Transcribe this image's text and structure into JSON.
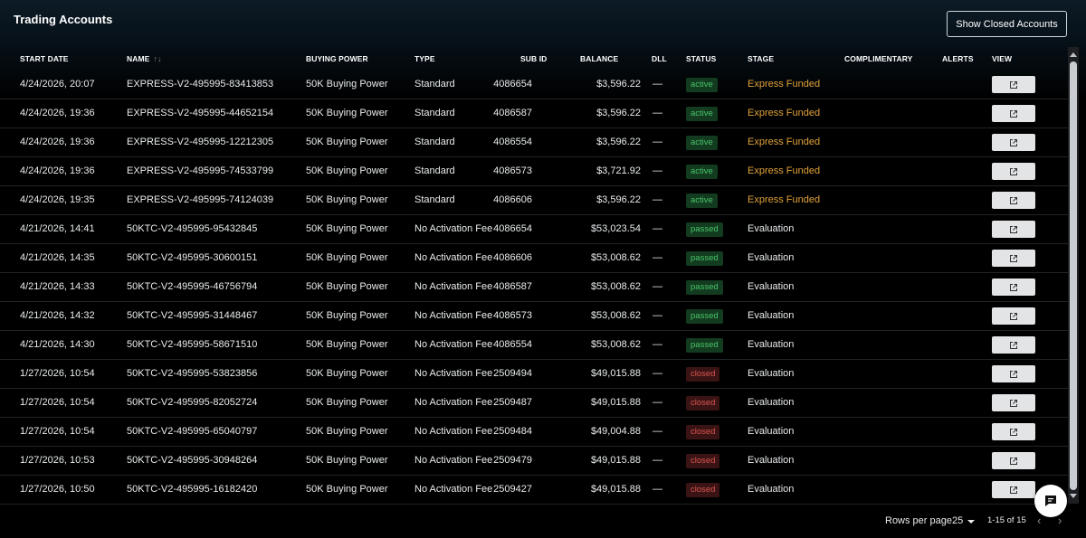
{
  "page": {
    "title": "Trading Accounts",
    "show_closed_label": "Show Closed Accounts"
  },
  "table": {
    "headers": {
      "start_date": "START DATE",
      "name": "NAME",
      "buying_power": "BUYING POWER",
      "type": "TYPE",
      "sub_id": "SUB ID",
      "balance": "BALANCE",
      "dll": "DLL",
      "status": "STATUS",
      "stage": "STAGE",
      "complimentary": "COMPLIMENTARY",
      "alerts": "ALERTS",
      "view": "VIEW"
    },
    "rows": [
      {
        "start_date": "4/24/2026, 20:07",
        "name": "EXPRESS-V2-495995-83413853",
        "buying_power": "50K Buying Power",
        "type": "Standard",
        "sub_id": "4086654",
        "balance": "$3,596.22",
        "dll": "—",
        "status": "active",
        "stage": "Express Funded"
      },
      {
        "start_date": "4/24/2026, 19:36",
        "name": "EXPRESS-V2-495995-44652154",
        "buying_power": "50K Buying Power",
        "type": "Standard",
        "sub_id": "4086587",
        "balance": "$3,596.22",
        "dll": "—",
        "status": "active",
        "stage": "Express Funded"
      },
      {
        "start_date": "4/24/2026, 19:36",
        "name": "EXPRESS-V2-495995-12212305",
        "buying_power": "50K Buying Power",
        "type": "Standard",
        "sub_id": "4086554",
        "balance": "$3,596.22",
        "dll": "—",
        "status": "active",
        "stage": "Express Funded"
      },
      {
        "start_date": "4/24/2026, 19:36",
        "name": "EXPRESS-V2-495995-74533799",
        "buying_power": "50K Buying Power",
        "type": "Standard",
        "sub_id": "4086573",
        "balance": "$3,721.92",
        "dll": "—",
        "status": "active",
        "stage": "Express Funded"
      },
      {
        "start_date": "4/24/2026, 19:35",
        "name": "EXPRESS-V2-495995-74124039",
        "buying_power": "50K Buying Power",
        "type": "Standard",
        "sub_id": "4086606",
        "balance": "$3,596.22",
        "dll": "—",
        "status": "active",
        "stage": "Express Funded"
      },
      {
        "start_date": "4/21/2026, 14:41",
        "name": "50KTC-V2-495995-95432845",
        "buying_power": "50K Buying Power",
        "type": "No Activation Fee",
        "sub_id": "4086654",
        "balance": "$53,023.54",
        "dll": "—",
        "status": "passed",
        "stage": "Evaluation"
      },
      {
        "start_date": "4/21/2026, 14:35",
        "name": "50KTC-V2-495995-30600151",
        "buying_power": "50K Buying Power",
        "type": "No Activation Fee",
        "sub_id": "4086606",
        "balance": "$53,008.62",
        "dll": "—",
        "status": "passed",
        "stage": "Evaluation"
      },
      {
        "start_date": "4/21/2026, 14:33",
        "name": "50KTC-V2-495995-46756794",
        "buying_power": "50K Buying Power",
        "type": "No Activation Fee",
        "sub_id": "4086587",
        "balance": "$53,008.62",
        "dll": "—",
        "status": "passed",
        "stage": "Evaluation"
      },
      {
        "start_date": "4/21/2026, 14:32",
        "name": "50KTC-V2-495995-31448467",
        "buying_power": "50K Buying Power",
        "type": "No Activation Fee",
        "sub_id": "4086573",
        "balance": "$53,008.62",
        "dll": "—",
        "status": "passed",
        "stage": "Evaluation"
      },
      {
        "start_date": "4/21/2026, 14:30",
        "name": "50KTC-V2-495995-58671510",
        "buying_power": "50K Buying Power",
        "type": "No Activation Fee",
        "sub_id": "4086554",
        "balance": "$53,008.62",
        "dll": "—",
        "status": "passed",
        "stage": "Evaluation"
      },
      {
        "start_date": "1/27/2026, 10:54",
        "name": "50KTC-V2-495995-53823856",
        "buying_power": "50K Buying Power",
        "type": "No Activation Fee",
        "sub_id": "2509494",
        "balance": "$49,015.88",
        "dll": "—",
        "status": "closed",
        "stage": "Evaluation"
      },
      {
        "start_date": "1/27/2026, 10:54",
        "name": "50KTC-V2-495995-82052724",
        "buying_power": "50K Buying Power",
        "type": "No Activation Fee",
        "sub_id": "2509487",
        "balance": "$49,015.88",
        "dll": "—",
        "status": "closed",
        "stage": "Evaluation"
      },
      {
        "start_date": "1/27/2026, 10:54",
        "name": "50KTC-V2-495995-65040797",
        "buying_power": "50K Buying Power",
        "type": "No Activation Fee",
        "sub_id": "2509484",
        "balance": "$49,004.88",
        "dll": "—",
        "status": "closed",
        "stage": "Evaluation"
      },
      {
        "start_date": "1/27/2026, 10:53",
        "name": "50KTC-V2-495995-30948264",
        "buying_power": "50K Buying Power",
        "type": "No Activation Fee",
        "sub_id": "2509479",
        "balance": "$49,015.88",
        "dll": "—",
        "status": "closed",
        "stage": "Evaluation"
      },
      {
        "start_date": "1/27/2026, 10:50",
        "name": "50KTC-V2-495995-16182420",
        "buying_power": "50K Buying Power",
        "type": "No Activation Fee",
        "sub_id": "2509427",
        "balance": "$49,015.88",
        "dll": "—",
        "status": "closed",
        "stage": "Evaluation"
      }
    ]
  },
  "pagination": {
    "rows_per_page_label": "Rows per page",
    "rows_per_page_value": "25",
    "range": "1-15 of 15"
  },
  "icons": {
    "sort": "sort-icon",
    "view": "external-link-icon",
    "chat": "chat-icon",
    "prev": "chevron-left-icon",
    "next": "chevron-right-icon"
  },
  "colors": {
    "active": "#49c46a",
    "closed": "#d9534f",
    "funded": "#e0a23a"
  }
}
